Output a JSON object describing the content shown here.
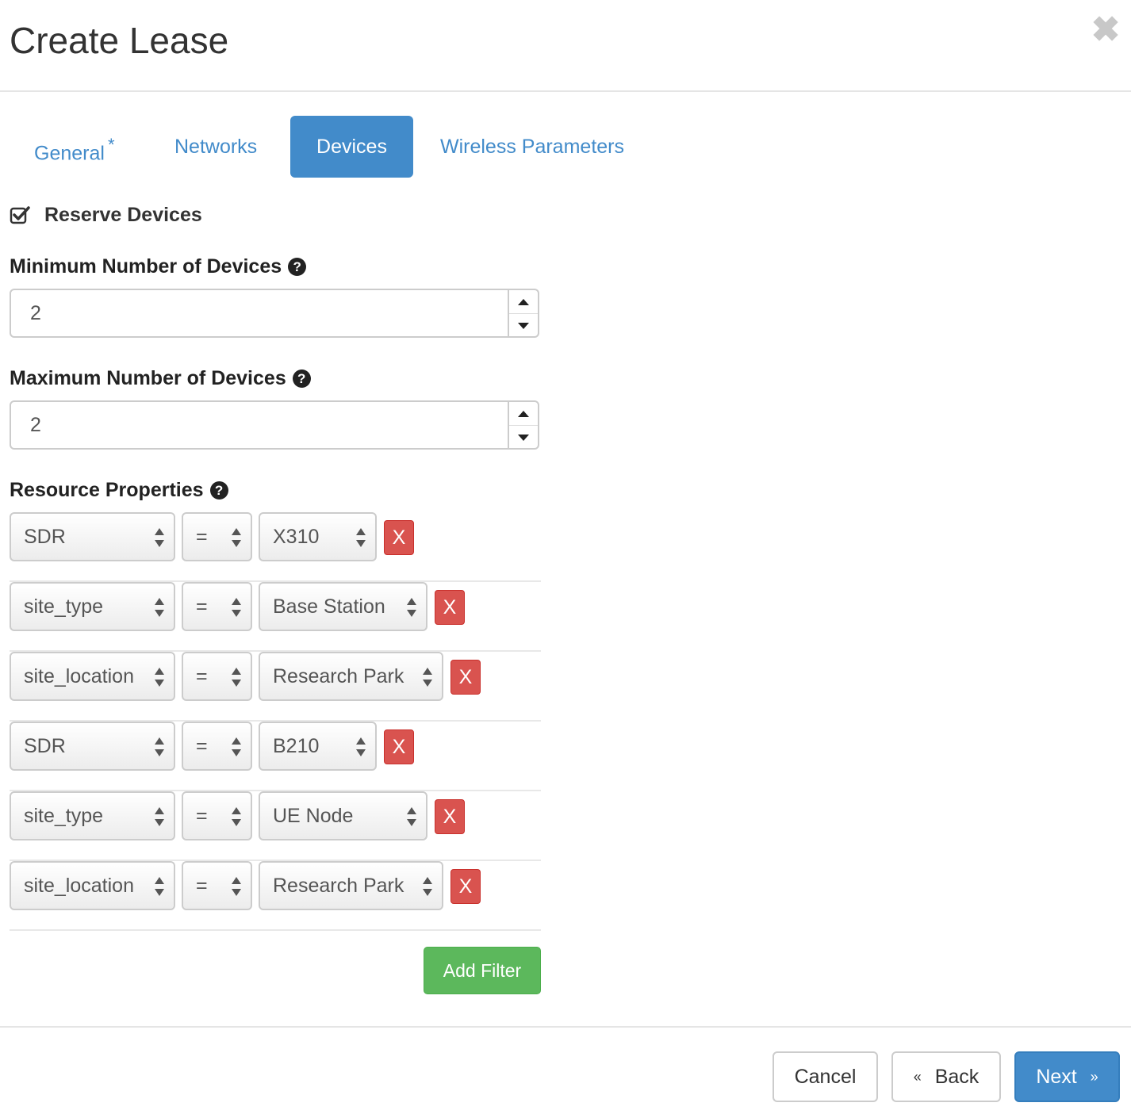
{
  "header": {
    "title": "Create Lease",
    "close_icon": "close-icon"
  },
  "tabs": [
    {
      "label": "General",
      "required_marker": "*"
    },
    {
      "label": "Networks"
    },
    {
      "label": "Devices",
      "active": true
    },
    {
      "label": "Wireless Parameters"
    }
  ],
  "reserve": {
    "label": "Reserve Devices",
    "checked": true
  },
  "min_devices": {
    "label": "Minimum Number of Devices",
    "value": "2"
  },
  "max_devices": {
    "label": "Maximum Number of Devices",
    "value": "2"
  },
  "resource_properties": {
    "label": "Resource Properties",
    "filters": [
      {
        "property": "SDR",
        "operator": "=",
        "value": "X310",
        "remove": "X"
      },
      {
        "property": "site_type",
        "operator": "=",
        "value": "Base Station",
        "remove": "X"
      },
      {
        "property": "site_location",
        "operator": "=",
        "value": "Research Park",
        "remove": "X"
      },
      {
        "property": "SDR",
        "operator": "=",
        "value": "B210",
        "remove": "X"
      },
      {
        "property": "site_type",
        "operator": "=",
        "value": "UE Node",
        "remove": "X"
      },
      {
        "property": "site_location",
        "operator": "=",
        "value": "Research Park",
        "remove": "X"
      }
    ],
    "add_filter_label": "Add Filter"
  },
  "footer": {
    "cancel_label": "Cancel",
    "back_label": "Back",
    "back_glyph": "«",
    "next_label": "Next",
    "next_glyph": "»"
  },
  "colors": {
    "accent": "#428bca",
    "danger": "#d9534f",
    "success": "#5cb85c"
  }
}
